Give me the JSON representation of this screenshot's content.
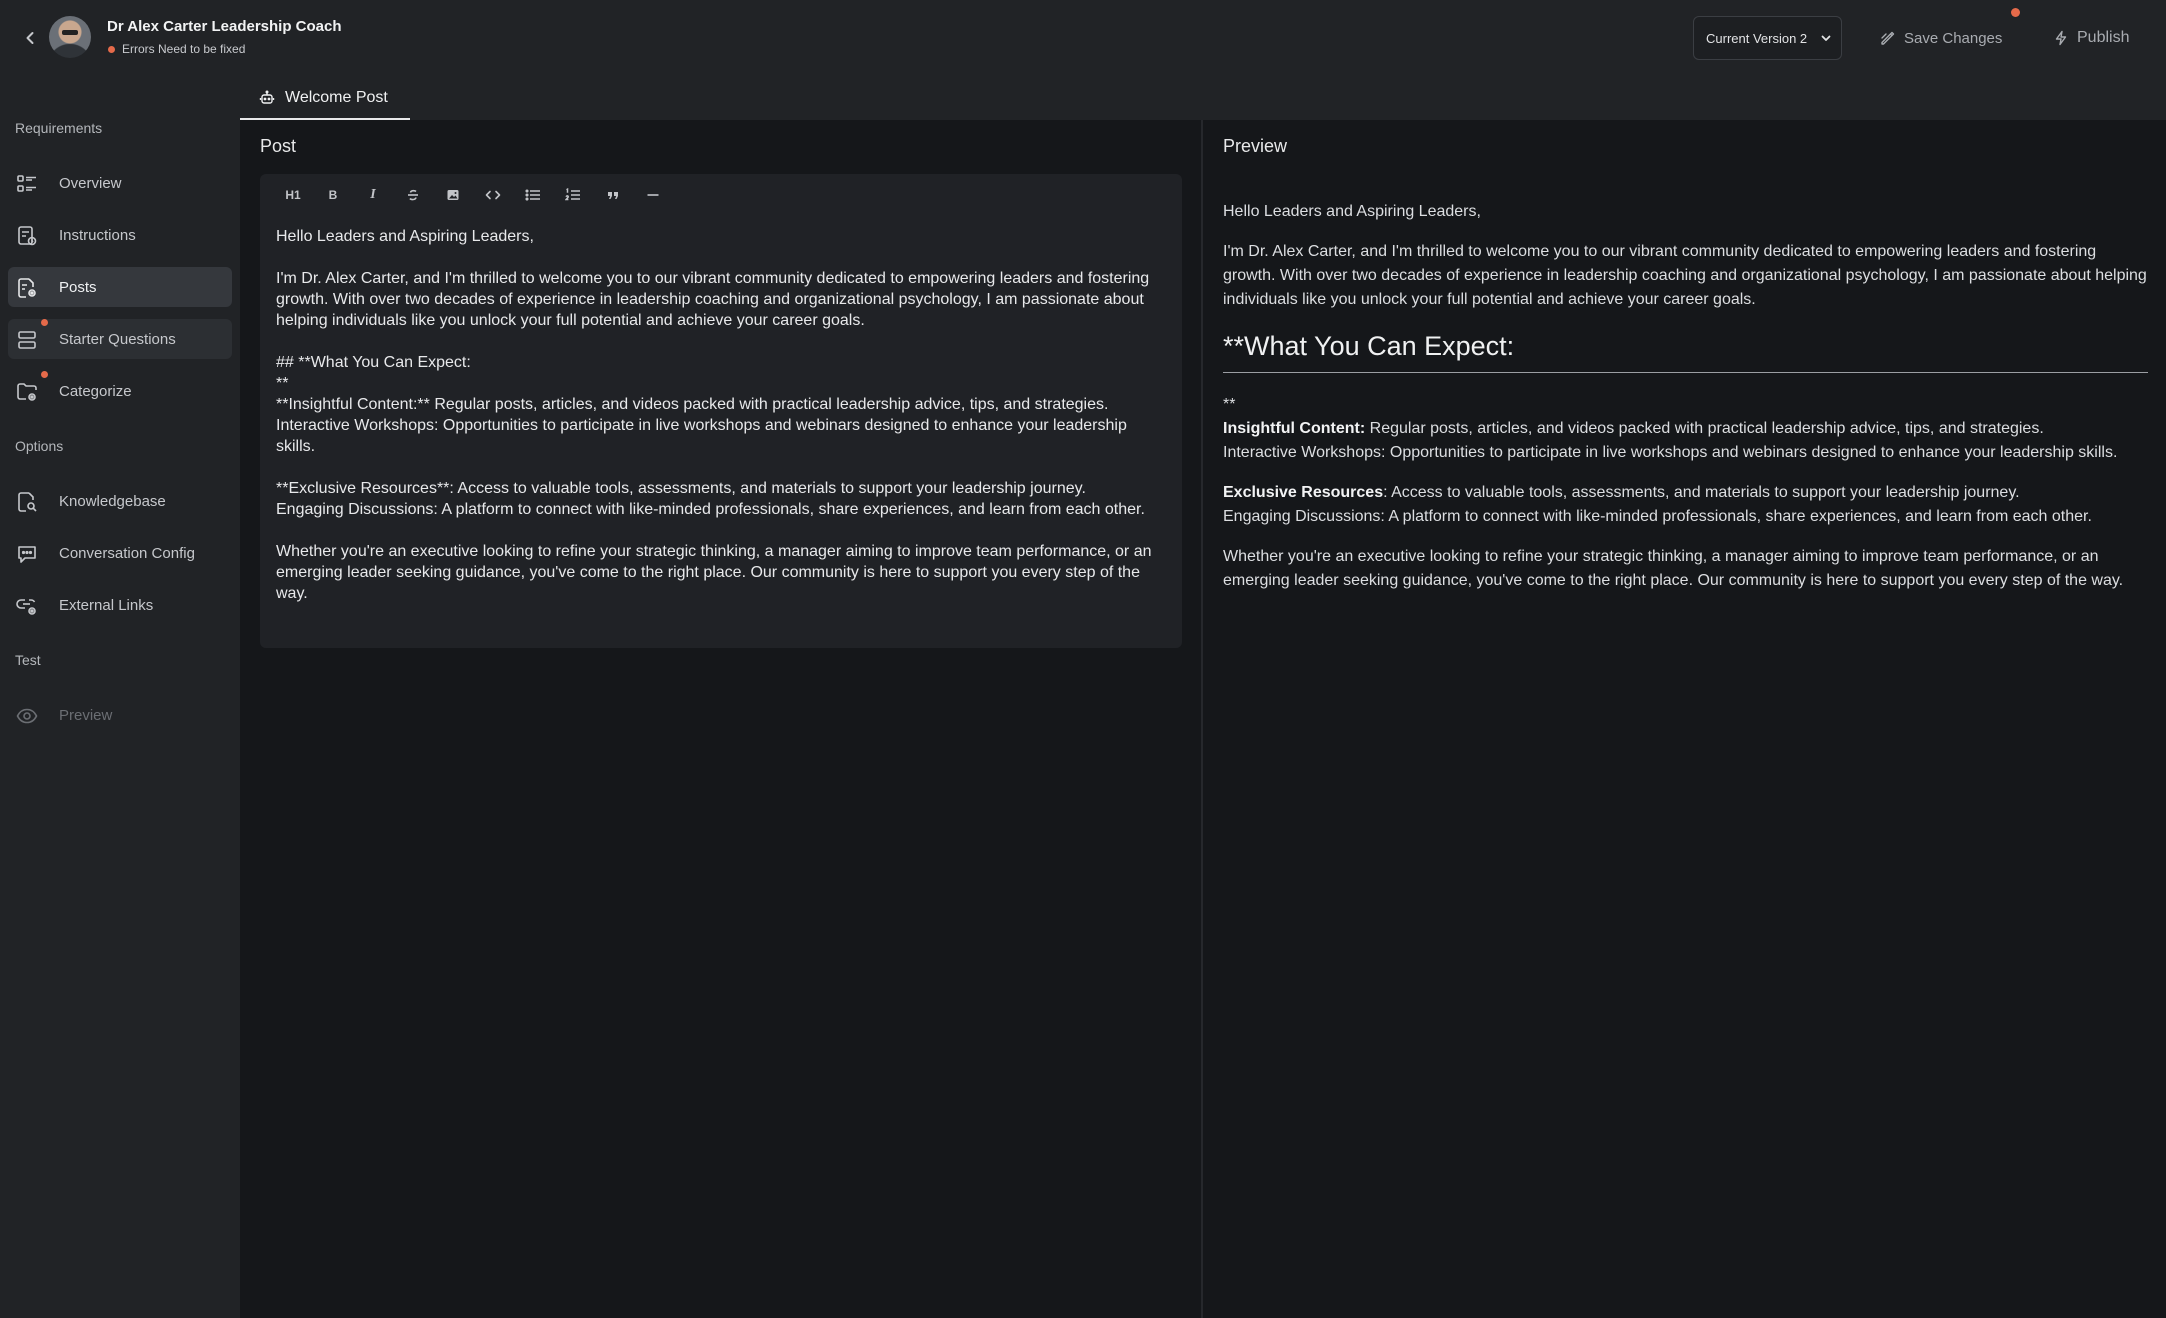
{
  "header": {
    "coach_name": "Dr Alex Carter Leadership Coach",
    "status_text": "Errors Need to be fixed",
    "version_label": "Current Version 2",
    "save_label": "Save Changes",
    "publish_label": "Publish"
  },
  "sidebar": {
    "sections": {
      "requirements": "Requirements",
      "options": "Options",
      "test": "Test"
    },
    "items": {
      "overview": "Overview",
      "instructions": "Instructions",
      "posts": "Posts",
      "starter_questions": "Starter Questions",
      "categorize": "Categorize",
      "knowledgebase": "Knowledgebase",
      "conversation_config": "Conversation Config",
      "external_links": "External Links",
      "preview": "Preview"
    }
  },
  "tabs": {
    "welcome_post": "Welcome Post"
  },
  "post": {
    "title": "Post",
    "toolbar": {
      "heading": "H1",
      "bold": "B",
      "italic": "I"
    },
    "content": "Hello Leaders and Aspiring Leaders,\n\nI'm Dr. Alex Carter, and I'm thrilled to welcome you to our vibrant community dedicated to empowering leaders and fostering growth. With over two decades of experience in leadership coaching and organizational psychology, I am passionate about helping individuals like you unlock your full potential and achieve your career goals.\n\n## **What You Can Expect:\n**\n**Insightful Content:** Regular posts, articles, and videos packed with practical leadership advice, tips, and strategies.\nInteractive Workshops: Opportunities to participate in live workshops and webinars designed to enhance your leadership skills.\n\n**Exclusive Resources**: Access to valuable tools, assessments, and materials to support your leadership journey.\nEngaging Discussions: A platform to connect with like-minded professionals, share experiences, and learn from each other.\n\nWhether you're an executive looking to refine your strategic thinking, a manager aiming to improve team performance, or an emerging leader seeking guidance, you've come to the right place. Our community is here to support you every step of the way."
  },
  "preview": {
    "title": "Preview",
    "greeting": "Hello Leaders and Aspiring Leaders,",
    "intro": "I'm Dr. Alex Carter, and I'm thrilled to welcome you to our vibrant community dedicated to empowering leaders and fostering growth. With over two decades of experience in leadership coaching and organizational psychology, I am passionate about helping individuals like you unlock your full potential and achieve your career goals.",
    "heading": "**What You Can Expect:",
    "stars": "**",
    "insightful_label": "Insightful Content:",
    "insightful_text": " Regular posts, articles, and videos packed with practical leadership advice, tips, and strategies.",
    "workshops_text": "Interactive Workshops: Opportunities to participate in live workshops and webinars designed to enhance your leadership skills.",
    "exclusive_label": "Exclusive Resources",
    "exclusive_text": ": Access to valuable tools, assessments, and materials to support your leadership journey.",
    "discussions_text": "Engaging Discussions: A platform to connect with like-minded professionals, share experiences, and learn from each other.",
    "closing": "Whether you're an executive looking to refine your strategic thinking, a manager aiming to improve team performance, or an emerging leader seeking guidance, you've come to the right place. Our community is here to support you every step of the way."
  },
  "colors": {
    "background": "#212326",
    "main_background": "#15171a",
    "editor_background": "#202226",
    "active_nav": "#35383d",
    "alert_dot": "#e56a4a",
    "text": "#e6e7e9"
  },
  "icons": {
    "back": "chevron-left-icon",
    "version_chevron": "chevron-down-icon",
    "save": "edit-icon",
    "publish": "bolt-icon",
    "tab": "robot-icon"
  }
}
